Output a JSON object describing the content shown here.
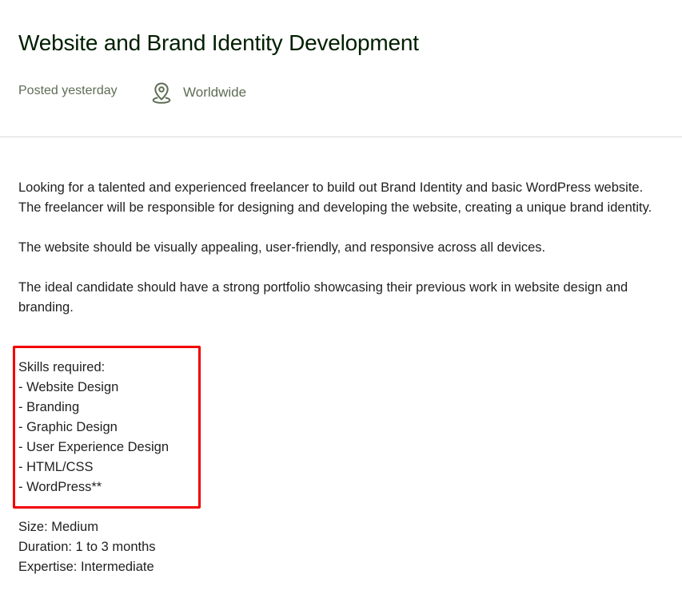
{
  "job": {
    "title": "Website and Brand Identity Development",
    "posted": "Posted yesterday",
    "location": "Worldwide",
    "icons": {
      "location": "map-pin-icon"
    }
  },
  "description": {
    "p1": "Looking for a talented and experienced freelancer to build out Brand Identity and basic WordPress website. The freelancer will be responsible for designing and developing the website, creating a unique brand identity.",
    "p2": "The website should be visually appealing, user-friendly, and responsive across all devices.",
    "p3": "The ideal candidate should have a strong portfolio showcasing their previous work in website design and branding."
  },
  "skills": {
    "heading": "Skills required:",
    "items": [
      "- Website Design",
      "- Branding",
      "- Graphic Design",
      "- User Experience Design",
      "- HTML/CSS",
      "- WordPress**"
    ],
    "highlight_color": "#f20000"
  },
  "details": {
    "size": "Size: Medium",
    "duration": "Duration: 1 to 3 months",
    "expertise": "Expertise: Intermediate"
  }
}
